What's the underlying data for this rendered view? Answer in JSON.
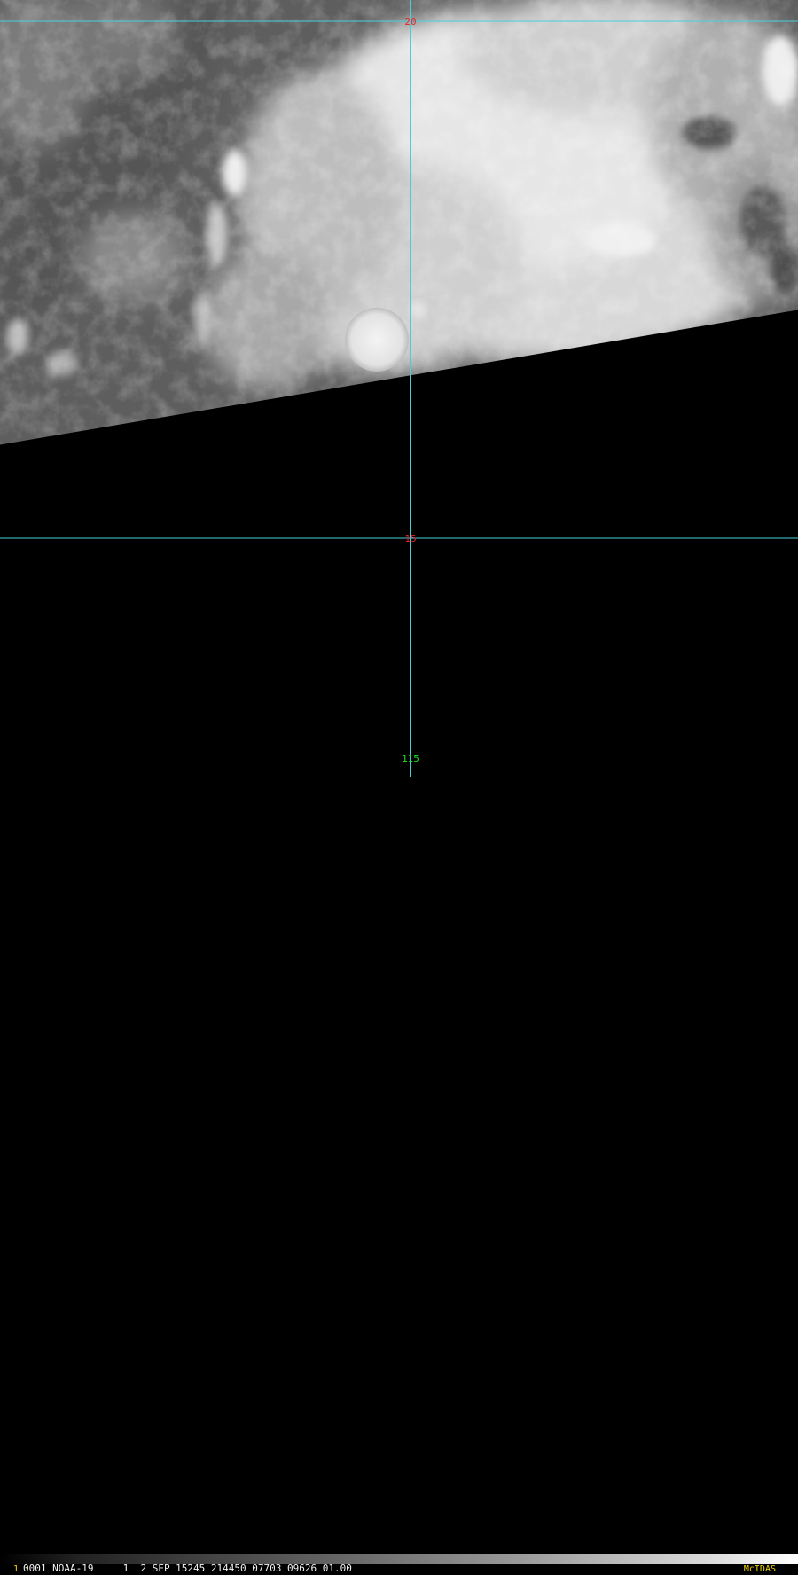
{
  "grid": {
    "color": "#44d0d8",
    "lat_labels": [
      "20",
      "15"
    ],
    "lat_label_color": "#e8242a",
    "lon_labels": [
      "115"
    ],
    "lon_label_color": "#22dd22"
  },
  "status": {
    "frame": "1",
    "text": "0001 NOAA-19     1  2 SEP 15245 214450 07703 09626 01.00",
    "brand": "McIDAS",
    "brand_color": "#f0d800"
  }
}
